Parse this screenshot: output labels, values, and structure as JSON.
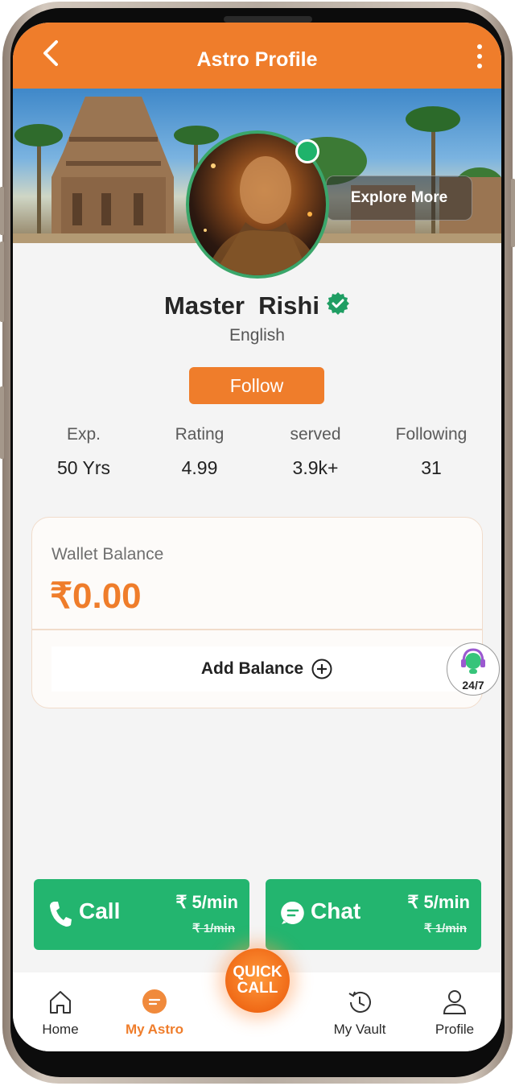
{
  "header": {
    "title": "Astro Profile"
  },
  "banner": {
    "explore_label": "Explore More"
  },
  "profile": {
    "name": "Master  Rishi",
    "language": "English",
    "follow_label": "Follow"
  },
  "stats": [
    {
      "label": "Exp.",
      "value": "50 Yrs"
    },
    {
      "label": "Rating",
      "value": "4.99"
    },
    {
      "label": "served",
      "value": "3.9k+"
    },
    {
      "label": "Following",
      "value": "31"
    }
  ],
  "wallet": {
    "label": "Wallet Balance",
    "amount": "₹0.00",
    "add_label": "Add Balance"
  },
  "support": {
    "label": "24/7"
  },
  "actions": {
    "call": {
      "label": "Call",
      "price": "₹ 5/min",
      "old_price": "₹ 1/min"
    },
    "chat": {
      "label": "Chat",
      "price": "₹ 5/min",
      "old_price": "₹ 1/min"
    }
  },
  "quick_call": {
    "line1": "QUICK",
    "line2": "CALL"
  },
  "nav": [
    {
      "label": "Home",
      "icon": "home-icon"
    },
    {
      "label": "My Astro",
      "icon": "chat-bubble-icon",
      "active": true
    },
    {
      "label": "My Vault",
      "icon": "history-icon"
    },
    {
      "label": "Profile",
      "icon": "user-icon"
    }
  ],
  "colors": {
    "primary": "#ef7d2b",
    "green": "#23b56f",
    "verified": "#1f9e63",
    "background": "#f4f4f4"
  }
}
